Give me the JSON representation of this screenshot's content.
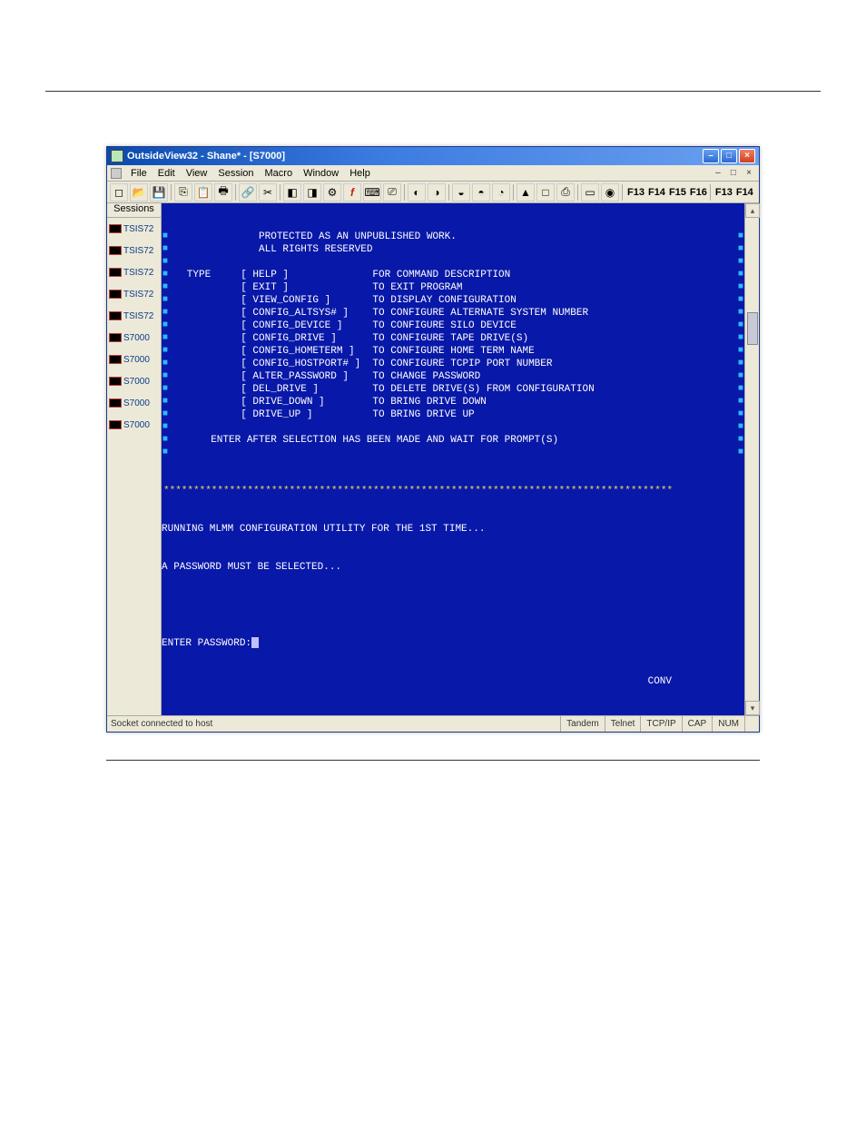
{
  "window": {
    "title": "OutsideView32 - Shane* - [S7000]"
  },
  "menu": {
    "items": [
      "File",
      "Edit",
      "View",
      "Session",
      "Macro",
      "Window",
      "Help"
    ]
  },
  "fkeys_left": [
    "F13",
    "F14",
    "F15",
    "F16"
  ],
  "fkeys_right": [
    "F13",
    "F14"
  ],
  "sessions": {
    "header": "Sessions",
    "items": [
      {
        "label": "TSIS72"
      },
      {
        "label": "TSIS72"
      },
      {
        "label": "TSIS72"
      },
      {
        "label": "TSIS72"
      },
      {
        "label": "TSIS72"
      },
      {
        "label": "S7000"
      },
      {
        "label": "S7000"
      },
      {
        "label": "S7000"
      },
      {
        "label": "S7000"
      },
      {
        "label": "S7000"
      }
    ]
  },
  "terminal": {
    "header1": "               PROTECTED AS AN UNPUBLISHED WORK.",
    "header2": "               ALL RIGHTS RESERVED",
    "type_label": "   TYPE",
    "cmds": [
      {
        "cmd": "[ HELP ]",
        "desc": "FOR COMMAND DESCRIPTION"
      },
      {
        "cmd": "[ EXIT ]",
        "desc": "TO EXIT PROGRAM"
      },
      {
        "cmd": "[ VIEW_CONFIG ]",
        "desc": "TO DISPLAY CONFIGURATION"
      },
      {
        "cmd": "[ CONFIG_ALTSYS# ]",
        "desc": "TO CONFIGURE ALTERNATE SYSTEM NUMBER"
      },
      {
        "cmd": "[ CONFIG_DEVICE ]",
        "desc": "TO CONFIGURE SILO DEVICE"
      },
      {
        "cmd": "[ CONFIG_DRIVE ]",
        "desc": "TO CONFIGURE TAPE DRIVE(S)"
      },
      {
        "cmd": "[ CONFIG_HOMETERM ]",
        "desc": "TO CONFIGURE HOME TERM NAME"
      },
      {
        "cmd": "[ CONFIG_HOSTPORT# ]",
        "desc": "TO CONFIGURE TCPIP PORT NUMBER"
      },
      {
        "cmd": "[ ALTER_PASSWORD ]",
        "desc": "TO CHANGE PASSWORD"
      },
      {
        "cmd": "[ DEL_DRIVE ]",
        "desc": "TO DELETE DRIVE(S) FROM CONFIGURATION"
      },
      {
        "cmd": "[ DRIVE_DOWN ]",
        "desc": "TO BRING DRIVE DOWN"
      },
      {
        "cmd": "[ DRIVE_UP ]",
        "desc": "TO BRING DRIVE UP"
      }
    ],
    "footer": "       ENTER AFTER SELECTION HAS BEEN MADE AND WAIT FOR PROMPT(S)",
    "divider": "*************************************************************************************",
    "run1": "RUNNING MLMM CONFIGURATION UTILITY FOR THE 1ST TIME...",
    "run2": "A PASSWORD MUST BE SELECTED...",
    "prompt": "ENTER PASSWORD:",
    "conv": "CONV"
  },
  "status": {
    "left": "Socket connected to host",
    "cells": [
      "Tandem",
      "Telnet",
      "TCP/IP",
      "CAP",
      "NUM",
      ""
    ]
  },
  "icons": {
    "new": "▯",
    "open": "📂",
    "save": "💾",
    "copy": "⎘",
    "paste": "📋",
    "print": "🖶"
  }
}
